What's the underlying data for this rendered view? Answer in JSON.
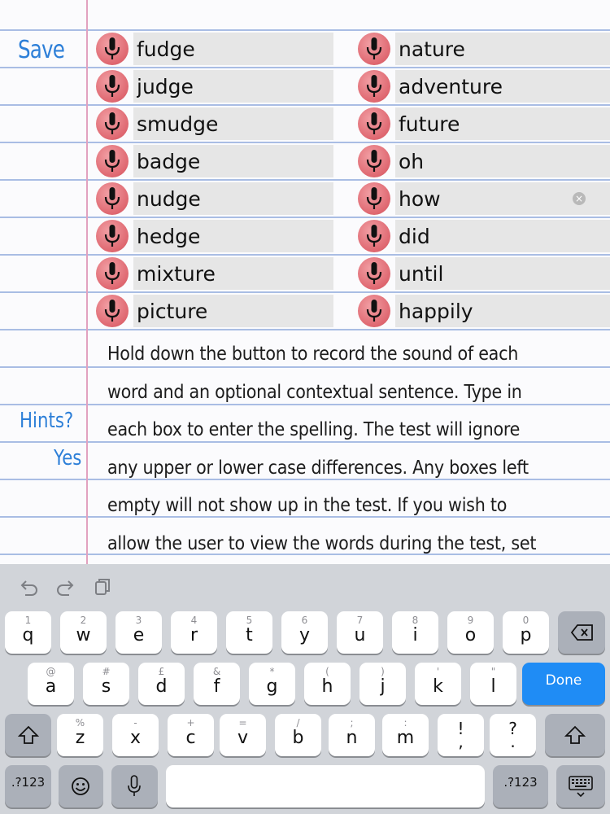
{
  "editor": {
    "save_label": "Save",
    "hints_label": "Hints?",
    "hints_value": "Yes",
    "words_left": [
      "fudge",
      "judge",
      "smudge",
      "badge",
      "nudge",
      "hedge",
      "mixture",
      "picture"
    ],
    "words_right": [
      "nature",
      "adventure",
      "future",
      "oh",
      "how",
      "did",
      "until",
      "happily"
    ],
    "instructions": "Hold down the button to record the sound of each word and an optional contextual sentence. Type in each box to enter the spelling. The test will ignore any upper or lower case differences. Any boxes left empty will not show up in the test. If you wish to allow the user to view the words during the test, set \"Hints?\" to"
  },
  "keyboard": {
    "toolbar_icons": [
      "undo-icon",
      "redo-icon",
      "paste-icon"
    ],
    "row1": [
      {
        "key": "q",
        "hint": "1"
      },
      {
        "key": "w",
        "hint": "2"
      },
      {
        "key": "e",
        "hint": "3"
      },
      {
        "key": "r",
        "hint": "4"
      },
      {
        "key": "t",
        "hint": "5"
      },
      {
        "key": "y",
        "hint": "6"
      },
      {
        "key": "u",
        "hint": "7"
      },
      {
        "key": "i",
        "hint": "8"
      },
      {
        "key": "o",
        "hint": "9"
      },
      {
        "key": "p",
        "hint": "0"
      }
    ],
    "row2": [
      {
        "key": "a",
        "hint": "@"
      },
      {
        "key": "s",
        "hint": "#"
      },
      {
        "key": "d",
        "hint": "£"
      },
      {
        "key": "f",
        "hint": "&"
      },
      {
        "key": "g",
        "hint": "*"
      },
      {
        "key": "h",
        "hint": "("
      },
      {
        "key": "j",
        "hint": ")"
      },
      {
        "key": "k",
        "hint": "'"
      },
      {
        "key": "l",
        "hint": "\""
      }
    ],
    "row3": [
      {
        "key": "z",
        "hint": "%"
      },
      {
        "key": "x",
        "hint": "-"
      },
      {
        "key": "c",
        "hint": "+"
      },
      {
        "key": "v",
        "hint": "="
      },
      {
        "key": "b",
        "hint": "/"
      },
      {
        "key": "n",
        "hint": ";"
      },
      {
        "key": "m",
        "hint": ":"
      },
      {
        "key": ",",
        "hint": "!"
      },
      {
        "key": ".",
        "hint": "?"
      }
    ],
    "done_label": "Done",
    "numbers_label": ".?123",
    "colors": {
      "accent": "#1f8cf5",
      "mic": "#df6770",
      "ink": "#2d7fd8"
    }
  }
}
